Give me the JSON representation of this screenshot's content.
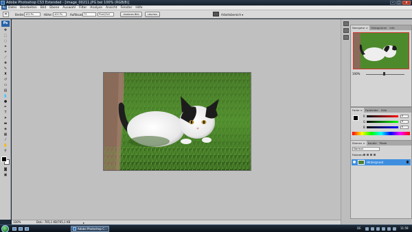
{
  "window": {
    "title": "Adobe Photoshop CS3 Extended - [image_00211.JPG bei 100% (RGB/8)]",
    "controls": [
      "–",
      "□",
      "x"
    ]
  },
  "menu": [
    "Datei",
    "Bearbeiten",
    "Bild",
    "Ebene",
    "Auswahl",
    "Filter",
    "Analyse",
    "Ansicht",
    "Fenster",
    "Hilfe"
  ],
  "options_bar": {
    "width_label": "Breite:",
    "width_value": "400 Px",
    "height_label": "Höhe:",
    "height_value": "400 Px",
    "resolution_label": "Auflösung:",
    "resolution_value": "72",
    "resolution_unit": "Pixel/Zoll",
    "front_image_button": "Vorderes Bild",
    "clear_button": "Löschen",
    "workspace_button": "Arbeitsbereich ▾"
  },
  "document": {
    "zoom": "100%",
    "doc_info": "Dok.: 765,1 KB/765,1 KB"
  },
  "panels": {
    "navigator_tabs": [
      "Navigator ×",
      "Histogramm",
      "Info"
    ],
    "navigator_zoom": "100%",
    "color_tabs": [
      "Farbe ×",
      "Farbfelder",
      "Stile"
    ],
    "color": {
      "r": {
        "label": "R",
        "value": "0"
      },
      "g": {
        "label": "G",
        "value": "0"
      },
      "b": {
        "label": "B",
        "value": "0"
      }
    },
    "layers_tabs": [
      "Ebenen ×",
      "Kanäle",
      "Pfade"
    ],
    "blend_mode": "Normal",
    "lock_label": "Fixieren:",
    "layer_name": "Hintergrund"
  },
  "taskbar": {
    "task_label": "Adobe Photoshop C...",
    "language": "DE",
    "time": "11:59"
  },
  "colors": {
    "workspace": "#c0c0c0",
    "selected_layer": "#3e8ee0",
    "navigator_frame": "#d2342c"
  }
}
